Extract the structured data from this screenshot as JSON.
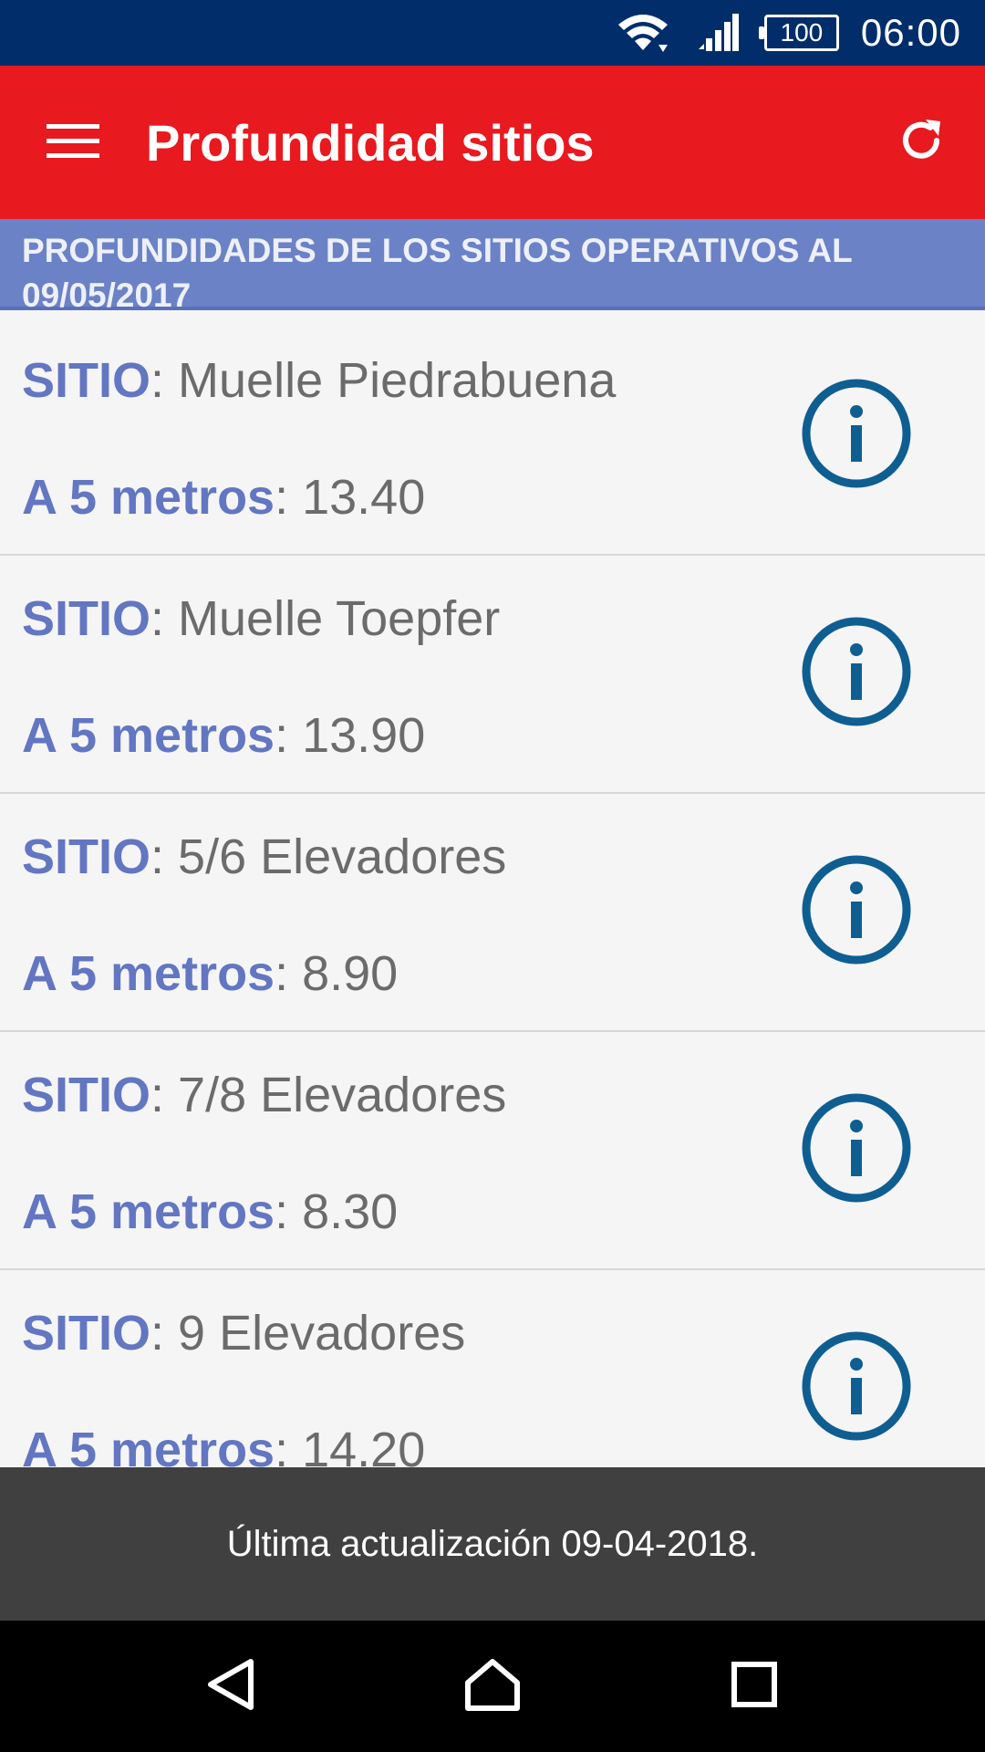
{
  "status_bar": {
    "battery_level": "100",
    "time": "06:00",
    "icons": [
      "wifi-icon",
      "signal-icon",
      "battery-icon"
    ]
  },
  "app_bar": {
    "title": "Profundidad sitios",
    "menu_icon": "hamburger-menu-icon",
    "refresh_icon": "refresh-icon",
    "background_color": "#e8191f"
  },
  "section_header": {
    "text": "PROFUNDIDADES DE LOS SITIOS OPERATIVOS AL 09/05/2017"
  },
  "list": {
    "site_label": "SITIO",
    "depth_label": "A 5 metros",
    "separator": ": ",
    "items": [
      {
        "site": "Muelle Piedrabuena",
        "depth": "13.40"
      },
      {
        "site": "Muelle Toepfer",
        "depth": "13.90"
      },
      {
        "site": "5/6 Elevadores",
        "depth": "8.90"
      },
      {
        "site": "7/8 Elevadores",
        "depth": "8.30"
      },
      {
        "site": "9 Elevadores",
        "depth": "14.20"
      }
    ]
  },
  "snackbar": {
    "text": "Última actualización 09-04-2018."
  },
  "nav_bar": {
    "icons": [
      "back-icon",
      "home-icon",
      "recents-icon"
    ]
  },
  "colors": {
    "status_bar": "#012e6a",
    "accent_label": "#6276c2",
    "info_icon": "#0f5e91",
    "header": "#6b82c6"
  }
}
